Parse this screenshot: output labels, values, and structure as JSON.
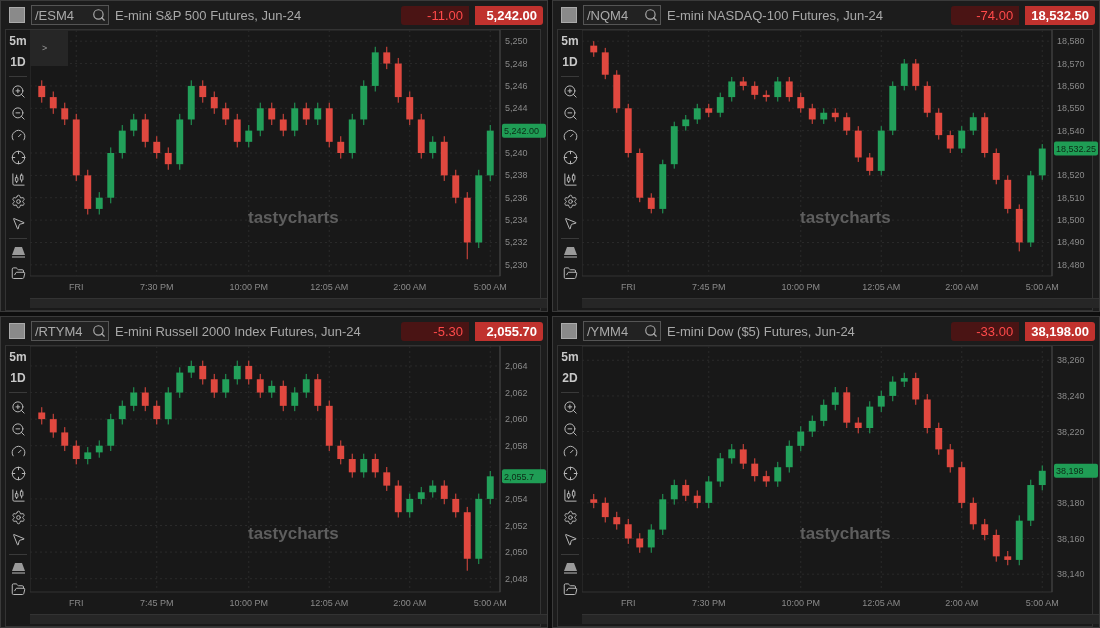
{
  "panels": [
    {
      "symbol": "/ESM4",
      "title": "E-mini S&P 500 Futures, Jun-24",
      "change": "-11.00",
      "price": "5,242.00",
      "interval": "5m",
      "range": "1D",
      "collapse_tab": ">",
      "watermark": "tastycharts",
      "price_label": "5,242.00",
      "chart_data": {
        "type": "candlestick",
        "grid": true,
        "ylim": [
          5229,
          5251
        ],
        "categories": [
          null,
          null,
          null,
          "FRI",
          null,
          null,
          null,
          null,
          null,
          null,
          "7:30 PM",
          null,
          null,
          null,
          null,
          null,
          null,
          null,
          "10:00 PM",
          null,
          null,
          null,
          null,
          null,
          null,
          "12:05 AM",
          null,
          null,
          null,
          null,
          null,
          null,
          "2:00 AM",
          null,
          null,
          null,
          null,
          null,
          null,
          "5:00 AM"
        ],
        "ohlc": [
          [
            5246,
            5246.5,
            5244.5,
            5245
          ],
          [
            5245,
            5245.5,
            5243.5,
            5244
          ],
          [
            5244,
            5244.5,
            5242.5,
            5243
          ],
          [
            5243,
            5243.5,
            5237.5,
            5238
          ],
          [
            5238,
            5238.5,
            5234.5,
            5235
          ],
          [
            5235,
            5236.5,
            5234.5,
            5236
          ],
          [
            5236,
            5240.5,
            5235.5,
            5240
          ],
          [
            5240,
            5242.5,
            5239.5,
            5242
          ],
          [
            5242,
            5243.5,
            5241.5,
            5243
          ],
          [
            5243,
            5243.5,
            5240.5,
            5241
          ],
          [
            5241,
            5241.5,
            5239.5,
            5240
          ],
          [
            5240,
            5240.5,
            5238.5,
            5239
          ],
          [
            5239,
            5243.5,
            5238.5,
            5243
          ],
          [
            5243,
            5246.5,
            5242.5,
            5246
          ],
          [
            5246,
            5246.5,
            5244.5,
            5245
          ],
          [
            5245,
            5245.5,
            5243.5,
            5244
          ],
          [
            5244,
            5244.5,
            5242.5,
            5243
          ],
          [
            5243,
            5243.5,
            5240.5,
            5241
          ],
          [
            5241,
            5242.5,
            5240.5,
            5242
          ],
          [
            5242,
            5244.5,
            5241.5,
            5244
          ],
          [
            5244,
            5244.5,
            5242.5,
            5243
          ],
          [
            5243,
            5243.5,
            5241.5,
            5242
          ],
          [
            5242,
            5244.5,
            5241.5,
            5244
          ],
          [
            5244,
            5244.5,
            5242.5,
            5243
          ],
          [
            5243,
            5244.5,
            5242.5,
            5244
          ],
          [
            5244,
            5244.5,
            5240.5,
            5241
          ],
          [
            5241,
            5241.5,
            5239.5,
            5240
          ],
          [
            5240,
            5243.5,
            5239.5,
            5243
          ],
          [
            5243,
            5246.5,
            5242.5,
            5246
          ],
          [
            5246,
            5249.5,
            5245.5,
            5249
          ],
          [
            5249,
            5249.5,
            5247.5,
            5248
          ],
          [
            5248,
            5248.5,
            5244.5,
            5245
          ],
          [
            5245,
            5245.5,
            5242.5,
            5243
          ],
          [
            5243,
            5243.5,
            5239.5,
            5240
          ],
          [
            5240,
            5241.5,
            5239.5,
            5241
          ],
          [
            5241,
            5241.5,
            5237.5,
            5238
          ],
          [
            5238,
            5238.5,
            5235.5,
            5236
          ],
          [
            5236,
            5236.5,
            5230.5,
            5232
          ],
          [
            5232,
            5238.5,
            5231.5,
            5238
          ],
          [
            5238,
            5242.5,
            5237.5,
            5242
          ]
        ],
        "yticks": [
          {
            "value": 5250,
            "label": "5,250"
          },
          {
            "value": 5248,
            "label": "5,248"
          },
          {
            "value": 5246,
            "label": "5,246"
          },
          {
            "value": 5244,
            "label": "5,244"
          },
          {
            "value": 5240,
            "label": "5,240"
          },
          {
            "value": 5238,
            "label": "5,238"
          },
          {
            "value": 5236,
            "label": "5,236"
          },
          {
            "value": 5234,
            "label": "5,234"
          },
          {
            "value": 5232,
            "label": "5,232"
          },
          {
            "value": 5230,
            "label": "5,230"
          }
        ]
      }
    },
    {
      "symbol": "/NQM4",
      "title": "E-mini NASDAQ-100 Futures, Jun-24",
      "change": "-74.00",
      "price": "18,532.50",
      "interval": "5m",
      "range": "1D",
      "watermark": "tastycharts",
      "price_label": "18,532.25",
      "chart_data": {
        "type": "candlestick",
        "grid": true,
        "ylim": [
          18475,
          18585
        ],
        "categories": [
          null,
          null,
          null,
          "FRI",
          null,
          null,
          null,
          null,
          null,
          null,
          "7:45 PM",
          null,
          null,
          null,
          null,
          null,
          null,
          null,
          "10:00 PM",
          null,
          null,
          null,
          null,
          null,
          null,
          "12:05 AM",
          null,
          null,
          null,
          null,
          null,
          null,
          "2:00 AM",
          null,
          null,
          null,
          null,
          null,
          null,
          "5:00 AM"
        ],
        "ohlc": [
          [
            18578,
            18580,
            18573,
            18575
          ],
          [
            18575,
            18577,
            18563,
            18565
          ],
          [
            18565,
            18567,
            18548,
            18550
          ],
          [
            18550,
            18552,
            18528,
            18530
          ],
          [
            18530,
            18532,
            18508,
            18510
          ],
          [
            18510,
            18512,
            18503,
            18505
          ],
          [
            18505,
            18527,
            18503,
            18525
          ],
          [
            18525,
            18544,
            18523,
            18542
          ],
          [
            18542,
            18547,
            18540,
            18545
          ],
          [
            18545,
            18552,
            18543,
            18550
          ],
          [
            18550,
            18552,
            18546,
            18548
          ],
          [
            18548,
            18557,
            18546,
            18555
          ],
          [
            18555,
            18564,
            18553,
            18562
          ],
          [
            18562,
            18564,
            18558,
            18560
          ],
          [
            18560,
            18562,
            18554,
            18556
          ],
          [
            18556,
            18558,
            18553,
            18555
          ],
          [
            18555,
            18564,
            18553,
            18562
          ],
          [
            18562,
            18564,
            18553,
            18555
          ],
          [
            18555,
            18557,
            18548,
            18550
          ],
          [
            18550,
            18552,
            18543,
            18545
          ],
          [
            18545,
            18550,
            18543,
            18548
          ],
          [
            18548,
            18550,
            18544,
            18546
          ],
          [
            18546,
            18548,
            18538,
            18540
          ],
          [
            18540,
            18542,
            18526,
            18528
          ],
          [
            18528,
            18530,
            18520,
            18522
          ],
          [
            18522,
            18542,
            18520,
            18540
          ],
          [
            18540,
            18562,
            18538,
            18560
          ],
          [
            18560,
            18572,
            18558,
            18570
          ],
          [
            18570,
            18572,
            18558,
            18560
          ],
          [
            18560,
            18562,
            18546,
            18548
          ],
          [
            18548,
            18550,
            18536,
            18538
          ],
          [
            18538,
            18540,
            18530,
            18532
          ],
          [
            18532,
            18542,
            18530,
            18540
          ],
          [
            18540,
            18548,
            18538,
            18546
          ],
          [
            18546,
            18548,
            18528,
            18530
          ],
          [
            18530,
            18532,
            18516,
            18518
          ],
          [
            18518,
            18520,
            18503,
            18505
          ],
          [
            18505,
            18507,
            18486,
            18490
          ],
          [
            18490,
            18522,
            18488,
            18520
          ],
          [
            18520,
            18534,
            18518,
            18532
          ]
        ],
        "yticks": [
          {
            "value": 18580,
            "label": "18,580"
          },
          {
            "value": 18570,
            "label": "18,570"
          },
          {
            "value": 18560,
            "label": "18,560"
          },
          {
            "value": 18550,
            "label": "18,550"
          },
          {
            "value": 18540,
            "label": "18,540"
          },
          {
            "value": 18520,
            "label": "18,520"
          },
          {
            "value": 18510,
            "label": "18,510"
          },
          {
            "value": 18500,
            "label": "18,500"
          },
          {
            "value": 18490,
            "label": "18,490"
          },
          {
            "value": 18480,
            "label": "18,480"
          }
        ]
      }
    },
    {
      "symbol": "/RTYM4",
      "title": "E-mini Russell 2000 Index Futures, Jun-24",
      "change": "-5.30",
      "price": "2,055.70",
      "interval": "5m",
      "range": "1D",
      "watermark": "tastycharts",
      "price_label": "2,055.7",
      "chart_data": {
        "type": "candlestick",
        "grid": true,
        "ylim": [
          2047,
          2065.5
        ],
        "categories": [
          null,
          null,
          null,
          "FRI",
          null,
          null,
          null,
          null,
          null,
          null,
          "7:45 PM",
          null,
          null,
          null,
          null,
          null,
          null,
          null,
          "10:00 PM",
          null,
          null,
          null,
          null,
          null,
          null,
          "12:05 AM",
          null,
          null,
          null,
          null,
          null,
          null,
          "2:00 AM",
          null,
          null,
          null,
          null,
          null,
          null,
          "5:00 AM"
        ],
        "ohlc": [
          [
            2060.5,
            2060.9,
            2059.6,
            2060
          ],
          [
            2060,
            2060.4,
            2058.6,
            2059
          ],
          [
            2059,
            2059.4,
            2057.6,
            2058
          ],
          [
            2058,
            2058.4,
            2056.6,
            2057
          ],
          [
            2057,
            2057.9,
            2056.6,
            2057.5
          ],
          [
            2057.5,
            2058.4,
            2057.1,
            2058
          ],
          [
            2058,
            2060.4,
            2057.6,
            2060
          ],
          [
            2060,
            2061.4,
            2059.6,
            2061
          ],
          [
            2061,
            2062.4,
            2060.6,
            2062
          ],
          [
            2062,
            2062.4,
            2060.6,
            2061
          ],
          [
            2061,
            2061.4,
            2059.6,
            2060
          ],
          [
            2060,
            2062.4,
            2059.6,
            2062
          ],
          [
            2062,
            2063.9,
            2061.6,
            2063.5
          ],
          [
            2063.5,
            2064.4,
            2063.1,
            2064
          ],
          [
            2064,
            2064.4,
            2062.6,
            2063
          ],
          [
            2063,
            2063.4,
            2061.6,
            2062
          ],
          [
            2062,
            2063.4,
            2061.6,
            2063
          ],
          [
            2063,
            2064.4,
            2062.6,
            2064
          ],
          [
            2064,
            2064.4,
            2062.6,
            2063
          ],
          [
            2063,
            2063.4,
            2061.6,
            2062
          ],
          [
            2062,
            2062.9,
            2061.6,
            2062.5
          ],
          [
            2062.5,
            2062.9,
            2060.6,
            2061
          ],
          [
            2061,
            2062.4,
            2060.6,
            2062
          ],
          [
            2062,
            2063.4,
            2061.6,
            2063
          ],
          [
            2063,
            2063.4,
            2060.6,
            2061
          ],
          [
            2061,
            2061.4,
            2057.6,
            2058
          ],
          [
            2058,
            2058.4,
            2056.6,
            2057
          ],
          [
            2057,
            2057.4,
            2055.6,
            2056
          ],
          [
            2056,
            2057.4,
            2055.6,
            2057
          ],
          [
            2057,
            2057.4,
            2055.6,
            2056
          ],
          [
            2056,
            2056.4,
            2054.6,
            2055
          ],
          [
            2055,
            2055.4,
            2052.6,
            2053
          ],
          [
            2053,
            2054.4,
            2052.6,
            2054
          ],
          [
            2054,
            2054.9,
            2053.6,
            2054.5
          ],
          [
            2054.5,
            2055.4,
            2054.1,
            2055
          ],
          [
            2055,
            2055.4,
            2053.6,
            2054
          ],
          [
            2054,
            2054.4,
            2052.6,
            2053
          ],
          [
            2053,
            2053.4,
            2048.6,
            2049.5
          ],
          [
            2049.5,
            2054.4,
            2049.1,
            2054
          ],
          [
            2054,
            2056.1,
            2053.6,
            2055.7
          ]
        ],
        "yticks": [
          {
            "value": 2064,
            "label": "2,064"
          },
          {
            "value": 2062,
            "label": "2,062"
          },
          {
            "value": 2060,
            "label": "2,060"
          },
          {
            "value": 2058,
            "label": "2,058"
          },
          {
            "value": 2054,
            "label": "2,054"
          },
          {
            "value": 2052,
            "label": "2,052"
          },
          {
            "value": 2050,
            "label": "2,050"
          },
          {
            "value": 2048,
            "label": "2,048"
          }
        ]
      }
    },
    {
      "symbol": "/YMM4",
      "title": "E-mini Dow ($5) Futures, Jun-24",
      "change": "-33.00",
      "price": "38,198.00",
      "interval": "5m",
      "range": "2D",
      "watermark": "tastycharts",
      "price_label": "38,198",
      "chart_data": {
        "type": "candlestick",
        "grid": true,
        "ylim": [
          38130,
          38268
        ],
        "categories": [
          null,
          null,
          null,
          "FRI",
          null,
          null,
          null,
          null,
          null,
          null,
          "7:30 PM",
          null,
          null,
          null,
          null,
          null,
          null,
          null,
          "10:00 PM",
          null,
          null,
          null,
          null,
          null,
          null,
          "12:05 AM",
          null,
          null,
          null,
          null,
          null,
          null,
          "2:00 AM",
          null,
          null,
          null,
          null,
          null,
          null,
          "5:00 AM"
        ],
        "ohlc": [
          [
            38182,
            38185,
            38177,
            38180
          ],
          [
            38180,
            38183,
            38169,
            38172
          ],
          [
            38172,
            38175,
            38165,
            38168
          ],
          [
            38168,
            38171,
            38157,
            38160
          ],
          [
            38160,
            38163,
            38152,
            38155
          ],
          [
            38155,
            38168,
            38152,
            38165
          ],
          [
            38165,
            38185,
            38162,
            38182
          ],
          [
            38182,
            38193,
            38179,
            38190
          ],
          [
            38190,
            38193,
            38181,
            38184
          ],
          [
            38184,
            38187,
            38177,
            38180
          ],
          [
            38180,
            38195,
            38177,
            38192
          ],
          [
            38192,
            38208,
            38189,
            38205
          ],
          [
            38205,
            38213,
            38202,
            38210
          ],
          [
            38210,
            38213,
            38199,
            38202
          ],
          [
            38202,
            38205,
            38192,
            38195
          ],
          [
            38195,
            38198,
            38189,
            38192
          ],
          [
            38192,
            38203,
            38189,
            38200
          ],
          [
            38200,
            38215,
            38197,
            38212
          ],
          [
            38212,
            38223,
            38209,
            38220
          ],
          [
            38220,
            38229,
            38217,
            38226
          ],
          [
            38226,
            38238,
            38223,
            38235
          ],
          [
            38235,
            38245,
            38232,
            38242
          ],
          [
            38242,
            38245,
            38222,
            38225
          ],
          [
            38225,
            38228,
            38219,
            38222
          ],
          [
            38222,
            38237,
            38219,
            38234
          ],
          [
            38234,
            38243,
            38231,
            38240
          ],
          [
            38240,
            38251,
            38237,
            38248
          ],
          [
            38248,
            38253,
            38245,
            38250
          ],
          [
            38250,
            38253,
            38235,
            38238
          ],
          [
            38238,
            38241,
            38219,
            38222
          ],
          [
            38222,
            38225,
            38207,
            38210
          ],
          [
            38210,
            38213,
            38197,
            38200
          ],
          [
            38200,
            38203,
            38177,
            38180
          ],
          [
            38180,
            38183,
            38165,
            38168
          ],
          [
            38168,
            38171,
            38159,
            38162
          ],
          [
            38162,
            38165,
            38147,
            38150
          ],
          [
            38150,
            38153,
            38145,
            38148
          ],
          [
            38148,
            38173,
            38145,
            38170
          ],
          [
            38170,
            38193,
            38167,
            38190
          ],
          [
            38190,
            38201,
            38187,
            38198
          ]
        ],
        "yticks": [
          {
            "value": 38260,
            "label": "38,260"
          },
          {
            "value": 38240,
            "label": "38,240"
          },
          {
            "value": 38220,
            "label": "38,220"
          },
          {
            "value": 38180,
            "label": "38,180"
          },
          {
            "value": 38160,
            "label": "38,160"
          },
          {
            "value": 38140,
            "label": "38,140"
          }
        ]
      }
    }
  ]
}
